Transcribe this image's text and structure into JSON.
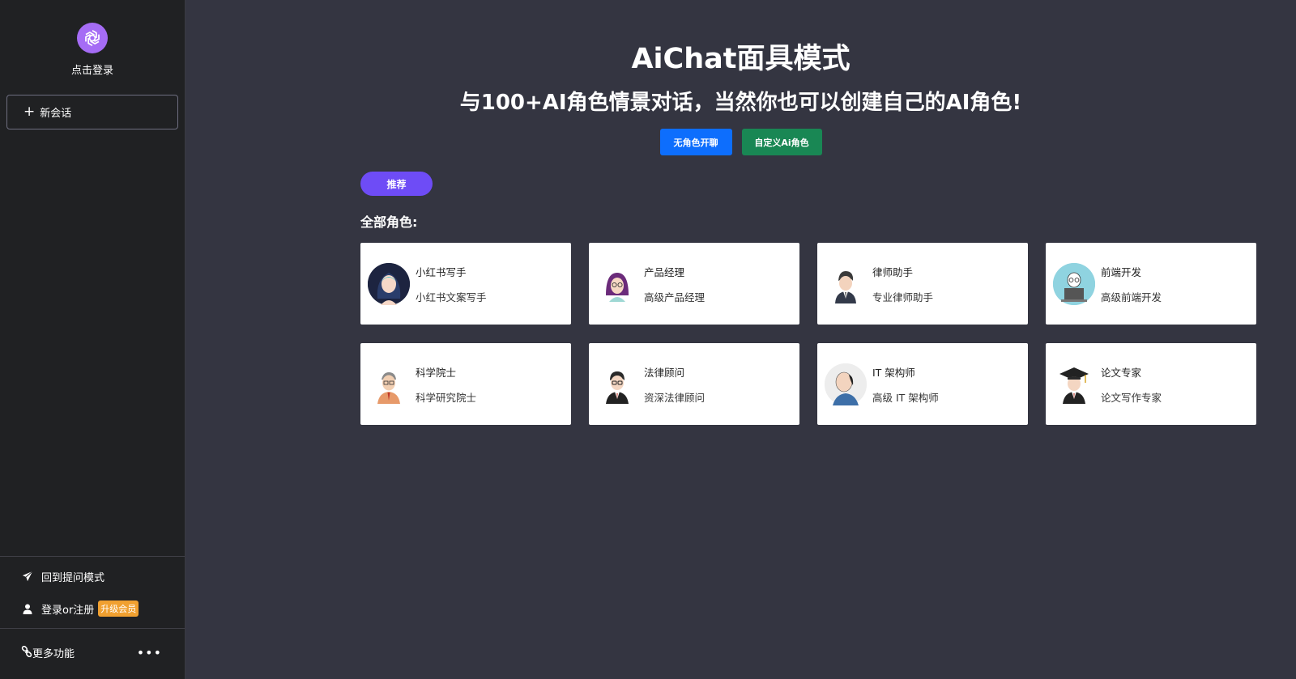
{
  "sidebar": {
    "login_text": "点击登录",
    "new_chat_label": "新会话",
    "items": [
      {
        "label": "回到提问模式",
        "icon": "send-icon"
      },
      {
        "label": "登录or注册",
        "icon": "user-icon",
        "badge": "升级会员"
      }
    ],
    "more_label": "更多功能",
    "logo_icon": "openai-logo-icon",
    "accent": "#a56cf5"
  },
  "main": {
    "title": "AiChat面具模式",
    "subtitle": "与100+AI角色情景对话，当然你也可以创建自己的AI角色!",
    "buttons": {
      "no_role": "无角色开聊",
      "custom_role": "自定义Ai角色"
    },
    "tab_recommend": "推荐",
    "section_label": "全部角色:",
    "roles": [
      {
        "name": "小红书写手",
        "desc": "小红书文案写手"
      },
      {
        "name": "产品经理",
        "desc": "高级产品经理"
      },
      {
        "name": "律师助手",
        "desc": "专业律师助手"
      },
      {
        "name": "前端开发",
        "desc": "高级前端开发"
      },
      {
        "name": "科学院士",
        "desc": "科学研究院士"
      },
      {
        "name": "法律顾问",
        "desc": "资深法律顾问"
      },
      {
        "name": "IT 架构师",
        "desc": "高级 IT 架构师"
      },
      {
        "name": "论文专家",
        "desc": "论文写作专家"
      }
    ],
    "colors": {
      "primary": "#0d6efd",
      "success": "#198754",
      "pill": "#6e4cf6",
      "background": "#343541",
      "sidebar": "#202123"
    }
  }
}
